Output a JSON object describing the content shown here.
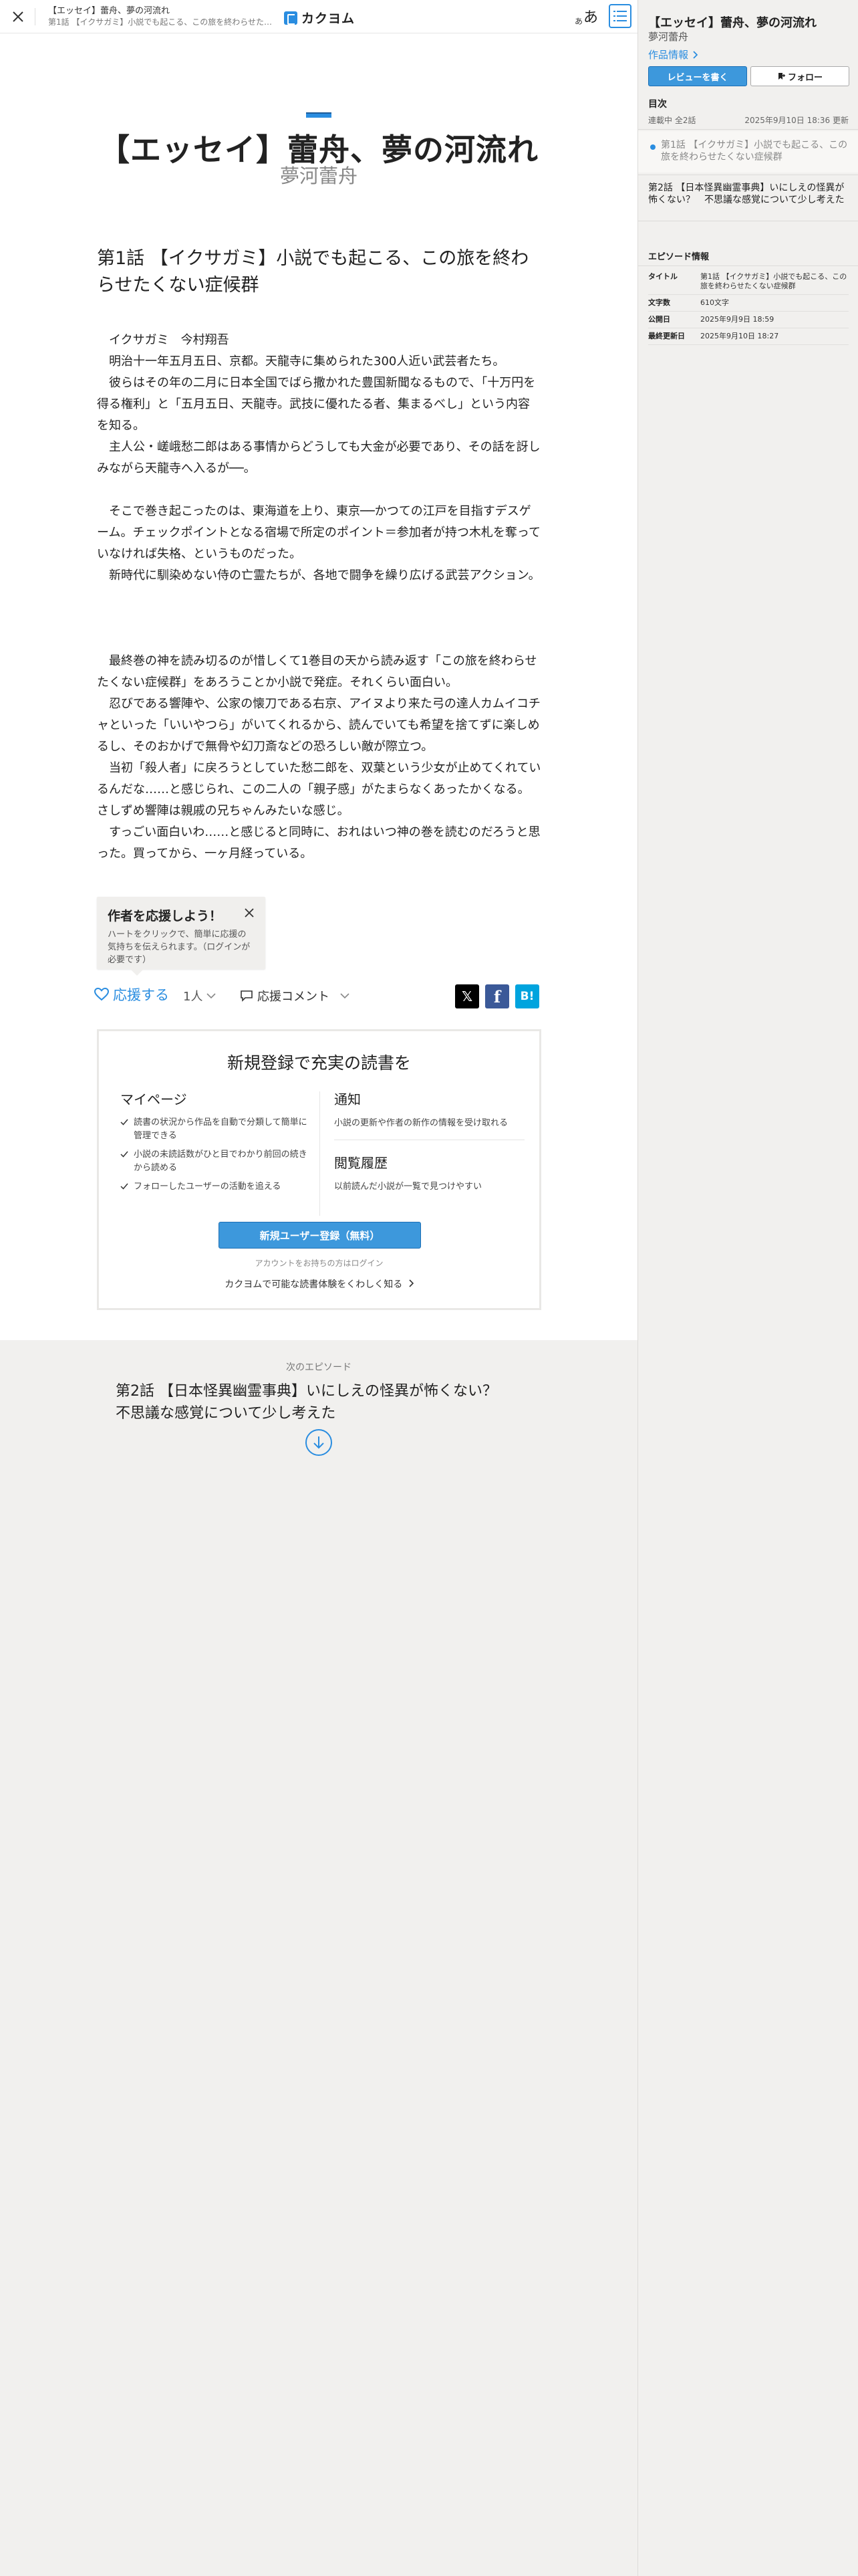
{
  "header": {
    "work_title": "【エッセイ】蕾舟、夢の河流れ",
    "episode_title": "第1話 【イクサガミ】小説でも起こる、この旅を終わらせたくない症候群",
    "logo_text": "カクヨム",
    "font_small": "あ",
    "font_big": "あ"
  },
  "work": {
    "title": "【エッセイ】蕾舟、夢の河流れ",
    "author": "夢河蕾舟"
  },
  "episode": {
    "title": "第1話 【イクサガミ】小説でも起こる、この旅を終わらせたくない症候群",
    "paragraphs": [
      "　イクサガミ　今村翔吾",
      "　明治十一年五月五日、京都。天龍寺に集められた300人近い武芸者たち。",
      "　彼らはその年の二月に日本全国でばら撒かれた豊国新聞なるもので、「十万円を得る権利」と「五月五日、天龍寺。武技に優れたる者、集まるべし」という内容を知る。",
      "　主人公・嵯峨愁二郎はある事情からどうしても大金が必要であり、その話を訝しみながら天龍寺へ入るが──。",
      "",
      "　そこで巻き起こったのは、東海道を上り、東京──かつての江戸を目指すデスゲーム。チェックポイントとなる宿場で所定のポイント＝参加者が持つ木札を奪っていなければ失格、というものだった。",
      "　新時代に馴染めない侍の亡霊たちが、各地で闘争を繰り広げる武芸アクション。",
      "",
      "",
      "",
      "　最終巻の神を読み切るのが惜しくて1巻目の天から読み返す「この旅を終わらせたくない症候群」をあろうことか小説で発症。それくらい面白い。",
      "　忍びである響陣や、公家の懐刀である右京、アイヌより来た弓の達人カムイコチャといった「いいやつら」がいてくれるから、読んでいても希望を捨てずに楽しめるし、そのおかげで無骨や幻刀斎などの恐ろしい敵が際立つ。",
      "　当初「殺人者」に戻ろうとしていた愁二郎を、双葉という少女が止めてくれているんだな……と感じられ、この二人の「親子感」がたまらなくあったかくなる。さしずめ響陣は親戚の兄ちゃんみたいな感じ。",
      "　すっごい面白いわ……と感じると同時に、おれはいつ神の巻を読むのだろうと思った。買ってから、一ヶ月経っている。"
    ]
  },
  "tooltip": {
    "title": "作者を応援しよう！",
    "desc": "ハートをクリックで、簡単に応援の気持ちを伝えられます。（ログインが必要です）"
  },
  "actions": {
    "support_label": "応援する",
    "support_count": "1人",
    "comment_label": "応援コメント",
    "share_x": "𝕏",
    "share_fb": "f",
    "share_hb": "B!"
  },
  "register": {
    "title": "新規登録で充実の読書を",
    "mypage_heading": "マイページ",
    "mypage_items": [
      "読書の状況から作品を自動で分類して簡単に管理できる",
      "小説の未読話数がひと目でわかり前回の続きから読める",
      "フォローしたユーザーの活動を追える"
    ],
    "notify_heading": "通知",
    "notify_text": "小説の更新や作者の新作の情報を受け取れる",
    "history_heading": "閲覧履歴",
    "history_text": "以前読んだ小説が一覧で見つけやすい",
    "button_label": "新規ユーザー登録（無料）",
    "login_link": "アカウントをお持ちの方はログイン",
    "more_link": "カクヨムで可能な読書体験をくわしく知る"
  },
  "next": {
    "label": "次のエピソード",
    "title": "第2話 【日本怪異幽霊事典】いにしえの怪異が怖くない？　不思議な感覚について少し考えた"
  },
  "sidebar": {
    "work_title": "【エッセイ】蕾舟、夢の河流れ",
    "author": "夢河蕾舟",
    "info_link": "作品情報",
    "review_button": "レビューを書く",
    "follow_button": "フォロー",
    "toc_heading": "目次",
    "toc_status": "連載中 全2話",
    "toc_updated": "2025年9月10日 18:36 更新",
    "episodes": [
      {
        "title": "第1話 【イクサガミ】小説でも起こる、この旅を終わらせたくない症候群"
      },
      {
        "title": "第2話 【日本怪異幽霊事典】いにしえの怪異が怖くない？　不思議な感覚について少し考えた"
      }
    ],
    "epinfo_heading": "エピソード情報",
    "epinfo": [
      {
        "key": "タイトル",
        "value": "第1話 【イクサガミ】小説でも起こる、この旅を終わらせたくない症候群"
      },
      {
        "key": "文字数",
        "value": "610文字"
      },
      {
        "key": "公開日",
        "value": "2025年9月9日 18:59"
      },
      {
        "key": "最終更新日",
        "value": "2025年9月10日 18:27"
      }
    ]
  },
  "colors": {
    "accent": "#2a8de0",
    "button_blue": "#3d98dc",
    "background": "#f1f0ee"
  }
}
